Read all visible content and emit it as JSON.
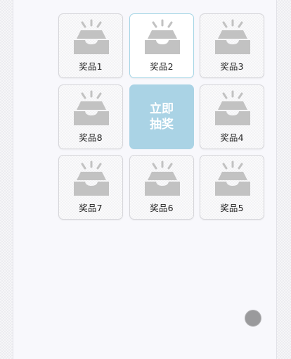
{
  "lottery": {
    "prizes": [
      {
        "label": "奖品1",
        "icon": "prize-box-icon"
      },
      {
        "label": "奖品2",
        "icon": "prize-box-icon"
      },
      {
        "label": "奖品3",
        "icon": "prize-box-icon"
      },
      {
        "label": "奖品4",
        "icon": "prize-box-icon"
      },
      {
        "label": "奖品5",
        "icon": "prize-box-icon"
      },
      {
        "label": "奖品6",
        "icon": "prize-box-icon"
      },
      {
        "label": "奖品7",
        "icon": "prize-box-icon"
      },
      {
        "label": "奖品8",
        "icon": "prize-box-icon"
      }
    ],
    "active_prize": "奖品2",
    "draw_button": {
      "line1": "立即",
      "line2": "抽奖"
    }
  },
  "colors": {
    "draw_button": "#aad3e5",
    "active_border": "#a6d6e6",
    "icon": "#c2c2c2",
    "float_ball": "#9a9a9c"
  },
  "icons": {
    "float_ball": "floating-action-ball"
  }
}
